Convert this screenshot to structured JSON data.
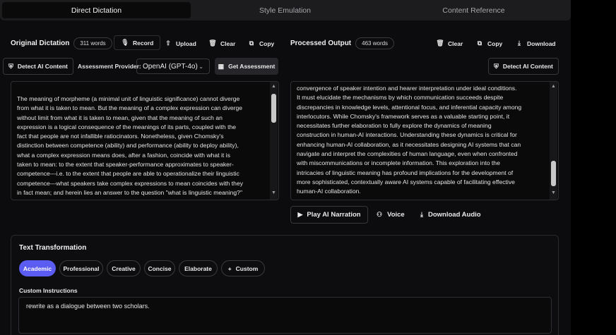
{
  "tabs": [
    {
      "label": "Direct Dictation",
      "active": true
    },
    {
      "label": "Style Emulation",
      "active": false
    },
    {
      "label": "Content Reference",
      "active": false
    }
  ],
  "left": {
    "title": "Original Dictation",
    "word_count": "311 words",
    "record": "Record",
    "upload": "Upload",
    "clear": "Clear",
    "copy": "Copy",
    "detect_ai": "Detect AI Content",
    "assessment_label": "Assessment Provider:",
    "provider": "OpenAI (GPT-4o)",
    "get_assessment": "Get Assessment",
    "text_lines": [
      "The meaning of morpheme (a minimal unit of linguistic significance) cannot diverge",
      "from what it is taken to mean. But the meaning of a complex expression can diverge",
      "without limit from what it is taken to mean, given that the meaning of such an",
      "expression is a logical consequence of the meanings of its parts, coupled with the",
      "fact that people are not infallible ratiocinators. Nonetheless, given Chomsky's",
      "distinction between competence (ability) and performance (ability to deploy ability),",
      "what a complex expression means does, after a fashion, coincide with what it is",
      "taken to mean: to the extent that speaker-performance approximates to speaker-",
      "competence---i.e. to the extent that people are able to operationalize their linguistic",
      "competence---what speakers take complex expressions to mean coincides with they",
      "in fact mean; and herein lies an answer to the question \"what is linguistic meaning?\""
    ]
  },
  "right": {
    "title": "Processed Output",
    "word_count": "463 words",
    "clear": "Clear",
    "copy": "Copy",
    "download": "Download",
    "detect_ai": "Detect AI Content",
    "text_lines": [
      "convergence of speaker intention and hearer interpretation under ideal conditions.",
      "It must elucidate the mechanisms by which communication succeeds despite",
      "discrepancies in knowledge levels, attentional focus, and inferential capacity among",
      "interlocutors. While Chomsky's framework serves as a valuable starting point, it",
      "necessitates further elaboration to fully explore the dynamics of meaning",
      "construction in human-AI interactions. Understanding these dynamics is critical for",
      "enhancing human-AI collaboration, as it necessitates designing AI systems that can",
      "navigate and interpret the complexities of human language, even when confronted",
      "with miscommunications or incomplete information. This exploration into the",
      "intricacies of linguistic meaning has profound implications for the development of",
      "more sophisticated, contextually aware AI systems capable of facilitating effective",
      "human-AI collaboration."
    ],
    "play": "Play AI Narration",
    "voice": "Voice",
    "download_audio": "Download Audio"
  },
  "transform": {
    "title": "Text Transformation",
    "chips": [
      "Academic",
      "Professional",
      "Creative",
      "Concise",
      "Elaborate",
      "Custom"
    ],
    "active_chip": "Academic",
    "custom_label": "Custom Instructions",
    "custom_value": "rewrite as a dialogue between two scholars."
  },
  "colors": {
    "accent": "#5b5cf2",
    "background": "#0c0c0e"
  }
}
